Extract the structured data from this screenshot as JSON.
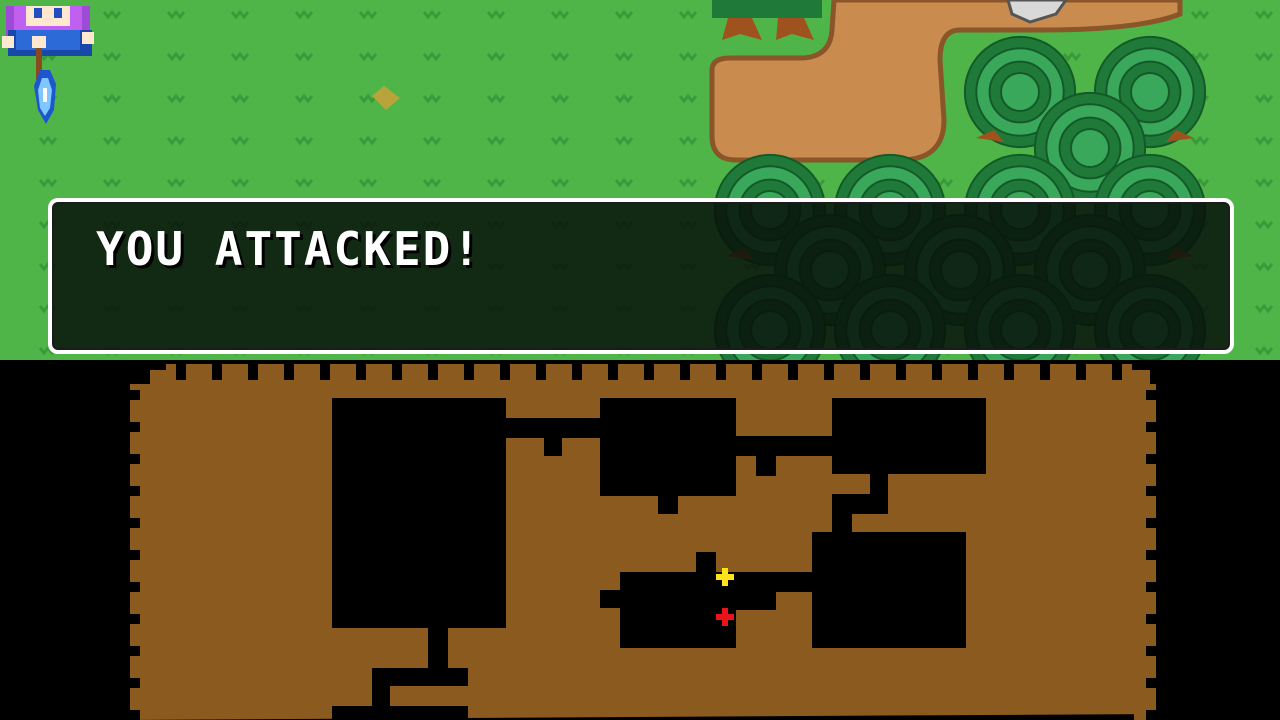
{
  "dialog": {
    "message": "YOU ATTACKED!"
  },
  "colors": {
    "grass": "#4fb548",
    "grass_tuft": "#3a9a3a",
    "dirt": "#c98c4e",
    "dirt_edge": "#8a5528",
    "tree_dark": "#1f7a3a",
    "tree_light": "#3aa85a",
    "trunk": "#a0521e",
    "map_floor": "#8b5a1e",
    "map_room": "#000000",
    "player_marker": "#ffe21a",
    "enemy_marker": "#e8141a",
    "dialog_border": "#ffffff"
  },
  "icons": {
    "hero": "hero-mage-sprite",
    "spell": "ice-bolt-projectile",
    "player": "player-marker-icon",
    "enemy": "enemy-marker-icon"
  }
}
